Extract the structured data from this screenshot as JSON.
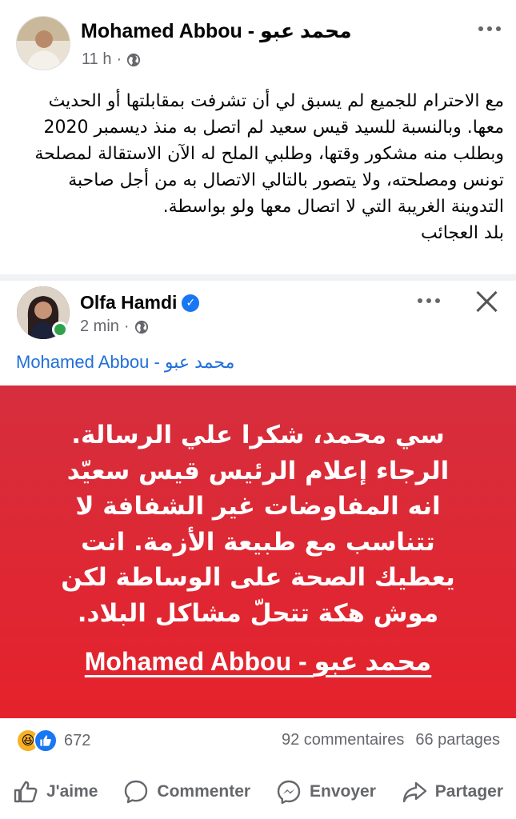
{
  "original_post": {
    "author": "Mohamed Abbou - محمد عبو",
    "time": "11 h",
    "separator": "·",
    "lines": [
      "مع الاحترام للجميع لم يسبق لي أن تشرفت بمقابلتها  أو الحديث",
      "معها. وبالنسبة للسيد قيس سعيد لم اتصل به منذ ديسمبر 2020",
      "وبطلب منه مشكور وقتها، وطلبي الملح له الآن الاستقالة لمصلحة",
      "تونس ومصلحته، ولا يتصور بالتالي الاتصال به من أجل صاحبة",
      "التدوينة الغريبة التي لا اتصال معها  ولو بواسطة.",
      "بلد العجائب"
    ]
  },
  "shared_post": {
    "author": "Olfa Hamdi",
    "verified": true,
    "time": "2 min",
    "separator": "·",
    "mention": "Mohamed Abbou - محمد عبو",
    "card_lines": [
      "سي محمد، شكرا علي الرسالة.",
      "الرجاء إعلام الرئيس قيس سعيّد",
      "انه المفاوضات غير الشفافة لا",
      "تتناسب مع طبيعة الأزمة. انت",
      "يعطيك الصحة على الوساطة لكن",
      "موش هكة تتحلّ مشاكل البلاد."
    ],
    "card_signature": "Mohamed Abbou - محمد عبو",
    "card_color": "#e0262f"
  },
  "stats": {
    "reactions_count": "672",
    "comments": "92 commentaires",
    "shares": "66 partages"
  },
  "actions": {
    "like": "J'aime",
    "comment": "Commenter",
    "send": "Envoyer",
    "share": "Partager"
  }
}
